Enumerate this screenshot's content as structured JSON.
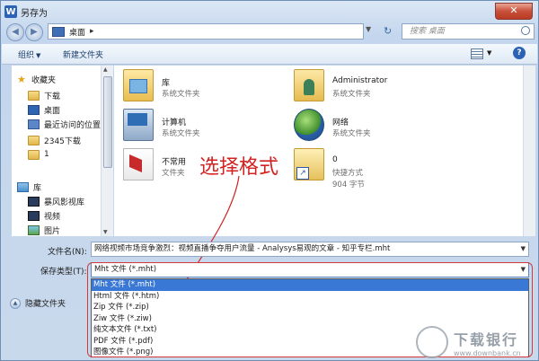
{
  "window": {
    "title": "另存为",
    "app_icon_letter": "W",
    "close_glyph": "✕"
  },
  "address": {
    "location": "桌面",
    "separator": "▸",
    "search_placeholder": "搜索 桌面"
  },
  "toolbar": {
    "organize": "组织",
    "new_folder": "新建文件夹",
    "help": "?"
  },
  "nav": {
    "items": [
      {
        "label": "收藏夹",
        "icon": "star-icon",
        "sub": false
      },
      {
        "label": "下载",
        "icon": "download-folder-icon",
        "sub": true
      },
      {
        "label": "桌面",
        "icon": "desktop-icon",
        "sub": true
      },
      {
        "label": "最近访问的位置",
        "icon": "recent-places-icon",
        "sub": true
      },
      {
        "label": "2345下载",
        "icon": "folder-icon",
        "sub": true
      },
      {
        "label": "1",
        "icon": "folder-icon",
        "sub": true
      },
      {
        "label": "库",
        "icon": "library-icon",
        "sub": false
      },
      {
        "label": "暴风影视库",
        "icon": "video-library-icon",
        "sub": true
      },
      {
        "label": "视频",
        "icon": "video-icon",
        "sub": true
      },
      {
        "label": "图片",
        "icon": "pictures-icon",
        "sub": true
      }
    ]
  },
  "content": {
    "items": [
      {
        "name": "库",
        "type": "系统文件夹",
        "size": "",
        "icon": "library-icon"
      },
      {
        "name": "Administrator",
        "type": "系统文件夹",
        "size": "",
        "icon": "user-folder-icon"
      },
      {
        "name": "计算机",
        "type": "系统文件夹",
        "size": "",
        "icon": "computer-icon"
      },
      {
        "name": "网络",
        "type": "系统文件夹",
        "size": "",
        "icon": "network-icon"
      },
      {
        "name": "不常用",
        "type": "文件夹",
        "size": "",
        "icon": "folder-icon"
      },
      {
        "name": "0",
        "type": "快捷方式",
        "size": "904 字节",
        "icon": "shortcut-icon"
      }
    ],
    "annotation": "选择格式"
  },
  "fields": {
    "filename_label": "文件名(N):",
    "filename_value": "网络视频市场竞争激烈：视频直播争夺用户流量 - Analysys易观的文章 - 知乎专栏.mht",
    "type_label": "保存类型(T):",
    "type_value": "Mht 文件 (*.mht)",
    "type_options": [
      "Mht 文件 (*.mht)",
      "Html 文件 (*.htm)",
      "Zip 文件 (*.zip)",
      "Ziw 文件 (*.ziw)",
      "纯文本文件 (*.txt)",
      "PDF 文件 (*.pdf)",
      "图像文件 (*.png)"
    ],
    "selected_index": 0,
    "hide_folders": "隐藏文件夹"
  },
  "watermark": {
    "cn": "下载银行",
    "en": "www.downbank.cn"
  }
}
